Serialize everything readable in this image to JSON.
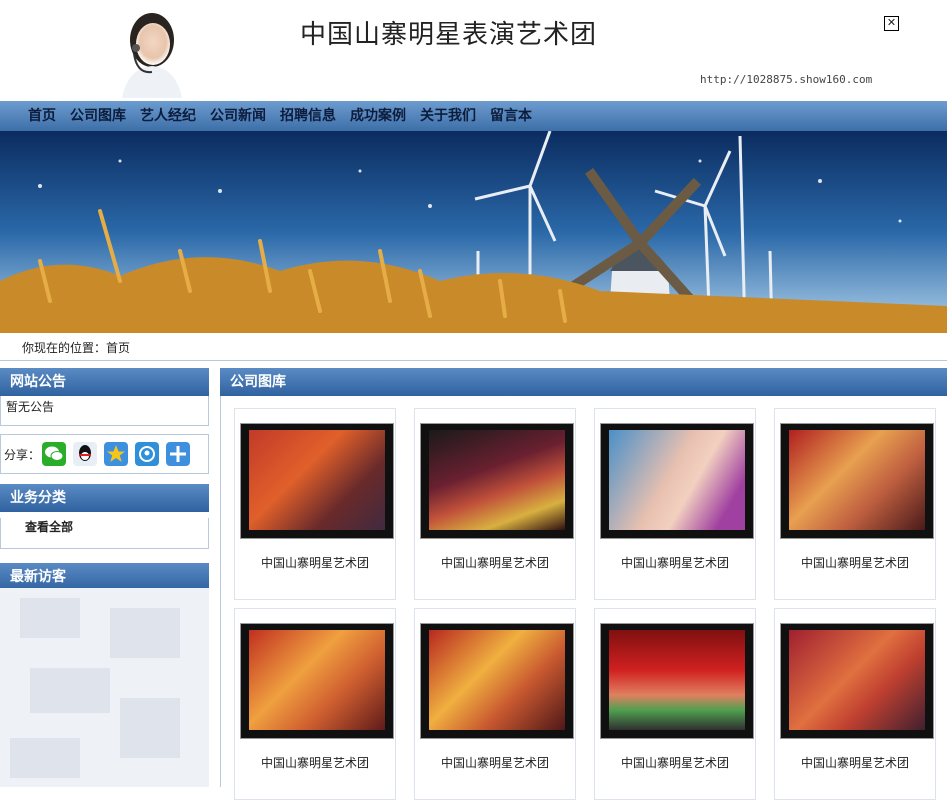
{
  "header": {
    "site_title": "中国山寨明星表演艺术团",
    "site_url": "http://1028875.show160.com",
    "close_label": "✕"
  },
  "nav": {
    "items": [
      "首页",
      "公司图库",
      "艺人经纪",
      "公司新闻",
      "招聘信息",
      "成功案例",
      "关于我们",
      "留言本"
    ]
  },
  "breadcrumb": {
    "text": "你现在的位置：首页"
  },
  "sidebar": {
    "notice_title": "网站公告",
    "notice_text": "暂无公告",
    "share_label": "分享：",
    "share_icons": [
      "wechat-icon",
      "qq-icon",
      "qzone-icon",
      "tencent-weibo-icon",
      "more-icon"
    ],
    "category_title": "业务分类",
    "category_link": "查看全部",
    "visitors_title": "最新访客"
  },
  "gallery": {
    "title": "公司图库",
    "items": [
      {
        "caption": "中国山寨明星艺术团"
      },
      {
        "caption": "中国山寨明星艺术团"
      },
      {
        "caption": "中国山寨明星艺术团"
      },
      {
        "caption": "中国山寨明星艺术团"
      },
      {
        "caption": "中国山寨明星艺术团"
      },
      {
        "caption": "中国山寨明星艺术团"
      },
      {
        "caption": "中国山寨明星艺术团"
      },
      {
        "caption": "中国山寨明星艺术团"
      }
    ]
  },
  "colors": {
    "nav_top": "#6d9ccf",
    "nav_bottom": "#3d6fa8",
    "title_bar": "#3a6eaa",
    "border": "#b8c9dc"
  }
}
